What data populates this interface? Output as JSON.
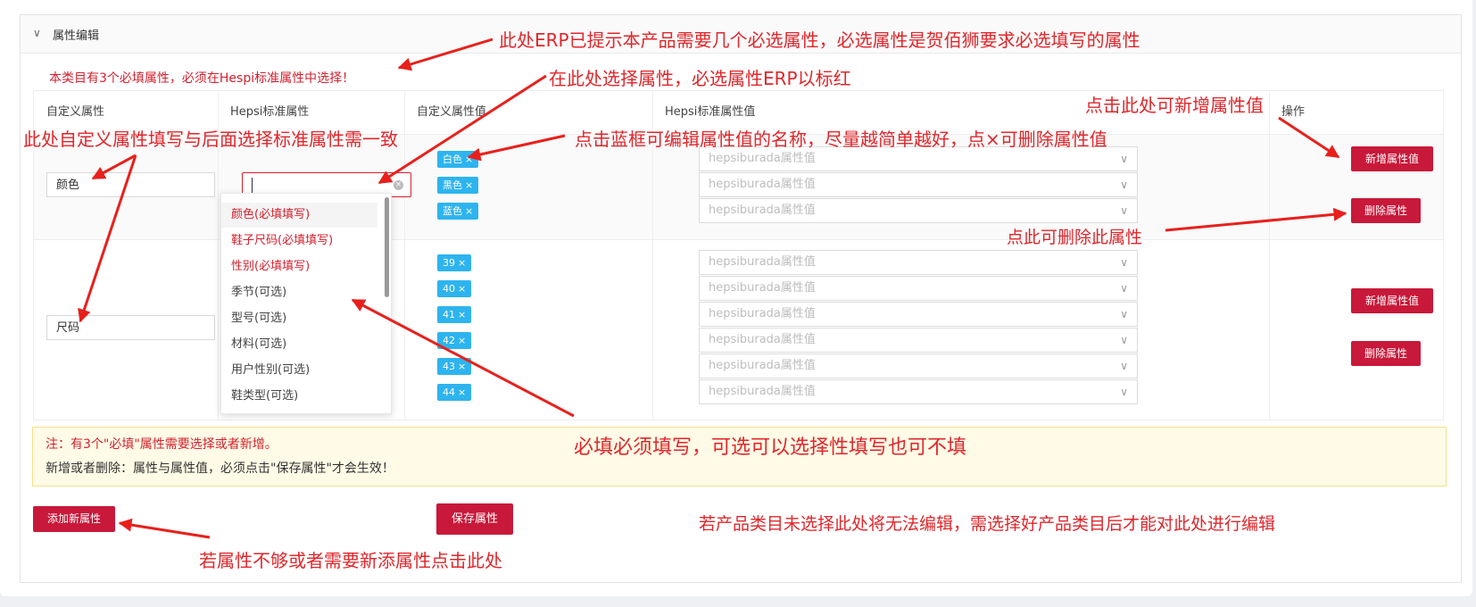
{
  "panel": {
    "title": "属性编辑",
    "warning": "本类目有3个必填属性，必须在Hespi标准属性中选择！"
  },
  "table": {
    "headers": [
      "自定义属性",
      "Hepsi标准属性",
      "自定义属性值",
      "Hepsi标准属性值",
      "操作"
    ],
    "rows": [
      {
        "custom_attr": "颜色",
        "value_tags": [
          "白色",
          "黑色",
          "蓝色"
        ]
      },
      {
        "custom_attr": "尺码",
        "value_tags": [
          "39",
          "40",
          "41",
          "42",
          "43",
          "44"
        ]
      }
    ],
    "value_select_placeholder": "hepsiburada属性值",
    "add_value_label": "新增属性值",
    "delete_attr_label": "删除属性"
  },
  "dropdown": {
    "options": [
      {
        "label": "颜色(必填填写)",
        "required": true
      },
      {
        "label": "鞋子尺码(必填填写)",
        "required": true
      },
      {
        "label": "性别(必填填写)",
        "required": true
      },
      {
        "label": "季节(可选)",
        "required": false
      },
      {
        "label": "型号(可选)",
        "required": false
      },
      {
        "label": "材料(可选)",
        "required": false
      },
      {
        "label": "用户性别(可选)",
        "required": false
      },
      {
        "label": "鞋类型(可选)",
        "required": false
      }
    ]
  },
  "notice": {
    "line1": "注：有3个\"必填\"属性需要选择或者新增。",
    "line2": "新增或者删除：属性与属性值，必须点击\"保存属性\"才会生效！"
  },
  "actions": {
    "add_attr": "添加新属性",
    "save_attr": "保存属性"
  },
  "annotations": {
    "erp_hint": "此处ERP已提示本产品需要几个必选属性，必选属性是贺佰狮要求必选填写的属性",
    "select_here": "在此处选择属性，必选属性ERP以标红",
    "add_value_hint": "点击此处可新增属性值",
    "custom_consistent": "此处自定义属性填写与后面选择标准属性需一致",
    "edit_tag_hint": "点击蓝框可编辑属性值的名称，尽量越简单越好，点×可删除属性值",
    "delete_hint": "点此可删除此属性",
    "required_optional": "必填必须填写，可选可以选择性填写也可不填",
    "category_hint": "若产品类目未选择此处将无法编辑，需选择好产品类目后才能对此处进行编辑",
    "add_attr_hint": "若属性不够或者需要新添属性点击此处"
  },
  "colors": {
    "accent_red": "#c8193a",
    "annotation_red": "#e0262b",
    "tag_blue": "#2db4ef"
  }
}
